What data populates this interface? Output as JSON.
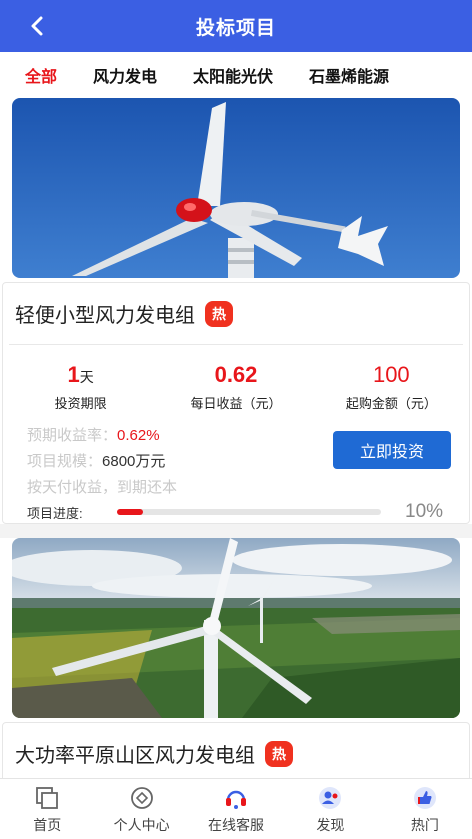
{
  "header": {
    "title": "投标项目"
  },
  "tabs": [
    {
      "label": "全部"
    },
    {
      "label": "风力发电"
    },
    {
      "label": "太阳能光伏"
    },
    {
      "label": "石墨烯能源"
    }
  ],
  "projects": [
    {
      "name": "轻便小型风力发电组",
      "badge": "热",
      "period_value": "1",
      "period_unit": "天",
      "period_label": "投资期限",
      "daily_income": "0.62",
      "daily_income_label": "每日收益（元）",
      "min_amount": "100",
      "min_amount_label": "起购金额（元）",
      "rate_label": "预期收益率：",
      "rate_value": "0.62%",
      "scale_label": "项目规模：",
      "scale_value": "6800万元",
      "repay_text": "按天付收益，到期还本",
      "invest_label": "立即投资",
      "progress_label": "项目进度:",
      "progress_text": "10%",
      "progress": 0.1
    },
    {
      "name": "大功率平原山区风力发电组",
      "badge": "热"
    }
  ],
  "bottom_nav": [
    {
      "label": "首页",
      "icon": "home-icon"
    },
    {
      "label": "个人中心",
      "icon": "user-center-icon"
    },
    {
      "label": "在线客服",
      "icon": "headset-icon"
    },
    {
      "label": "发现",
      "icon": "discover-icon"
    },
    {
      "label": "热门",
      "icon": "thumbs-up-icon"
    }
  ],
  "colors": {
    "header": "#3b5fe3",
    "accent_red": "#e8161b",
    "button_blue": "#1f6ad4"
  }
}
